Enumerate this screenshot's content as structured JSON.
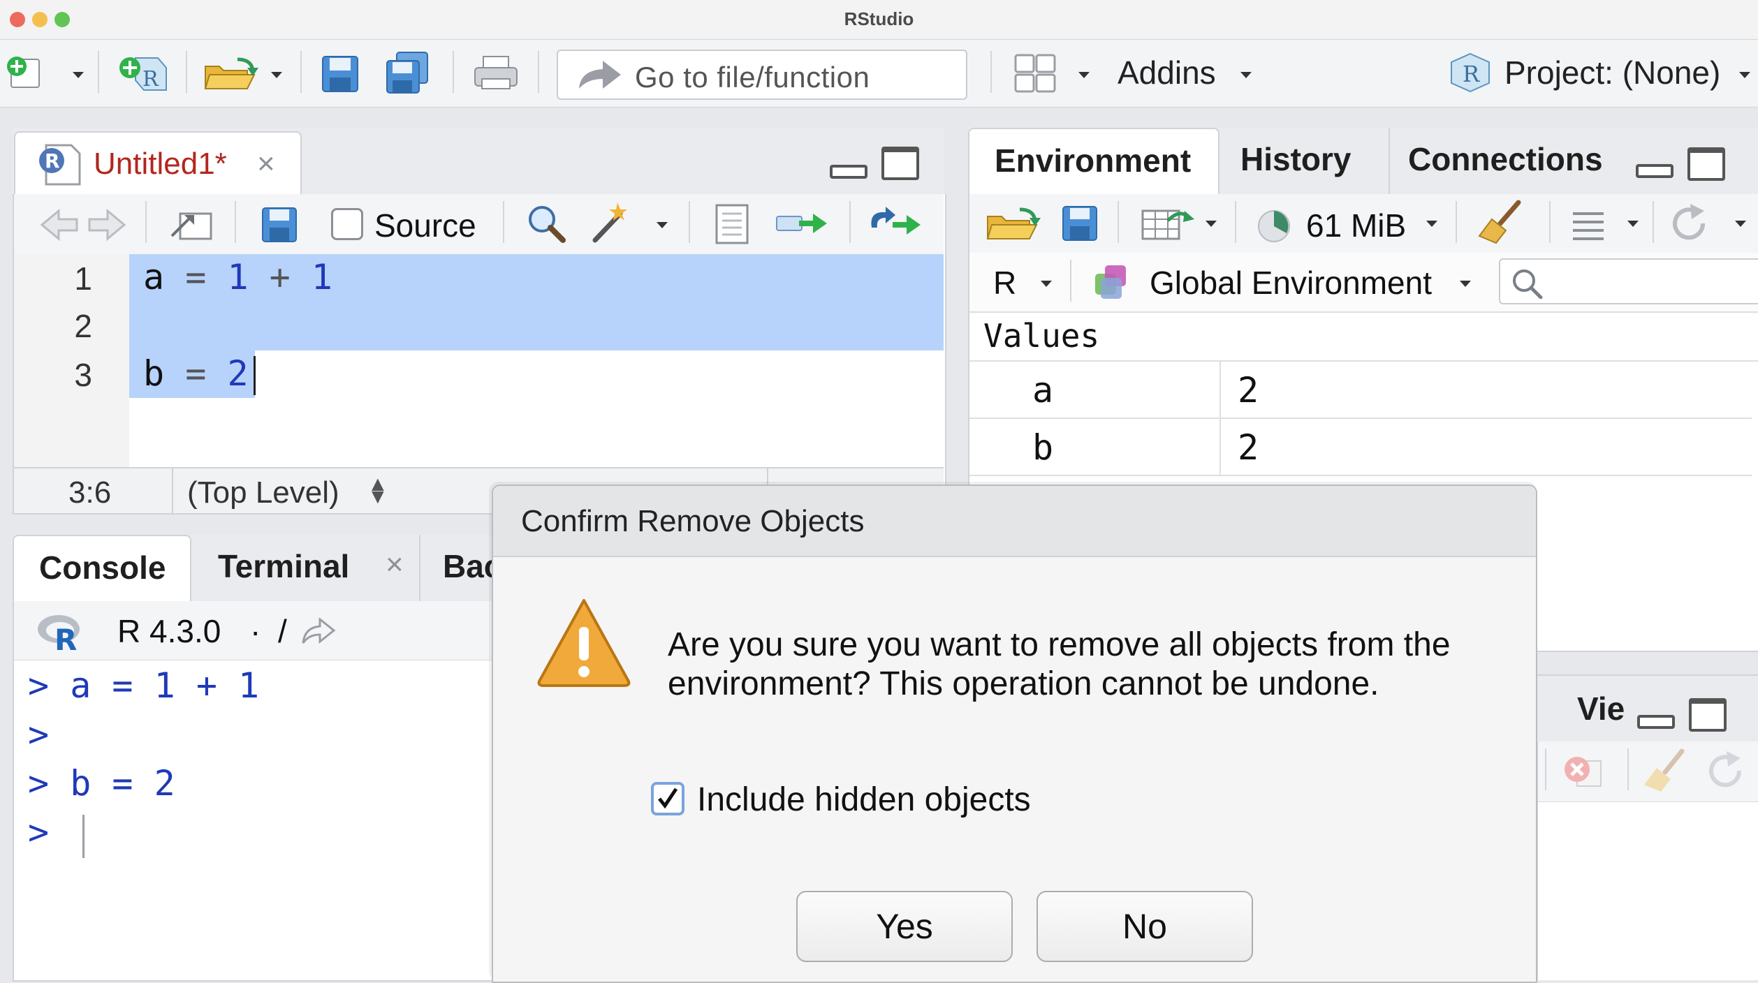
{
  "window": {
    "title": "RStudio"
  },
  "toolbar": {
    "goto_placeholder": "Go to file/function",
    "addins_label": "Addins",
    "project_label": "Project: (None)"
  },
  "editor": {
    "tab_name": "Untitled1*",
    "source_label": "Source",
    "line_numbers": [
      "1",
      "2",
      "3"
    ],
    "lines": [
      {
        "var": "a",
        "op1": "=",
        "n1": "1",
        "op2": "+",
        "n2": "1"
      },
      {
        "var": "b",
        "op1": "=",
        "n1": "2"
      }
    ],
    "status_position": "3:6",
    "status_scope": "(Top Level)"
  },
  "environment": {
    "tabs": [
      "Environment",
      "History",
      "Connections"
    ],
    "memory": "61 MiB",
    "language": "R",
    "scope": "Global Environment",
    "section_title": "Values",
    "values": [
      {
        "name": "a",
        "value": "2"
      },
      {
        "name": "b",
        "value": "2"
      }
    ]
  },
  "console": {
    "tabs": [
      "Console",
      "Terminal",
      "Bac"
    ],
    "r_version": "R 4.3.0",
    "working_dir": "/",
    "lines": [
      {
        "prompt": ">",
        "code": "a = 1 + 1"
      },
      {
        "prompt": ">",
        "code": ""
      },
      {
        "prompt": ">",
        "code": "b = 2"
      },
      {
        "prompt": ">",
        "code": ""
      }
    ]
  },
  "viewer": {
    "tab_label": "Vie"
  },
  "dialog": {
    "title": "Confirm Remove Objects",
    "message": "Are you sure you want to remove all objects from the environment? This operation cannot be undone.",
    "checkbox_label": "Include hidden objects",
    "checkbox_checked": true,
    "yes_label": "Yes",
    "no_label": "No"
  },
  "colors": {
    "selection": "#b7d3fb",
    "code_blue": "#1f39b8",
    "tab_modified": "#b3261e",
    "warning": "#f0a93a"
  },
  "icons": [
    "new-file-icon",
    "new-project-icon",
    "open-folder-icon",
    "save-icon",
    "save-all-icon",
    "print-icon",
    "goto-arrow-icon",
    "grid-layout-icon",
    "r-project-cube-icon",
    "back-arrow-icon",
    "forward-arrow-icon",
    "show-in-window-icon",
    "search-icon",
    "magic-wand-icon",
    "compile-report-icon",
    "run-icon",
    "rerun-icon",
    "import-dataset-icon",
    "memory-pie-icon",
    "broom-icon",
    "list-view-icon",
    "refresh-icon",
    "warning-icon",
    "r-logo-icon",
    "clear-x-icon"
  ]
}
